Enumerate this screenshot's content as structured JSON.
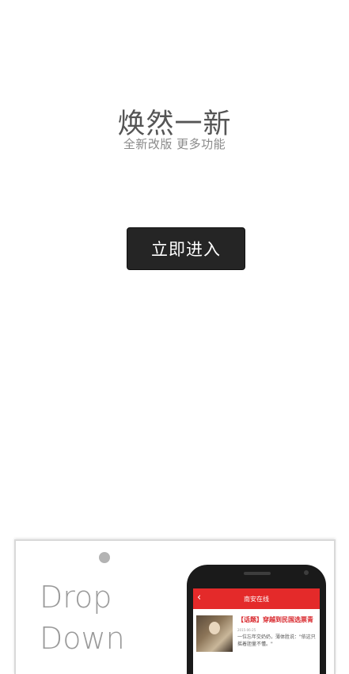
{
  "splash": {
    "headline": "焕然一新",
    "subhead": "全新改版  更多功能",
    "enter_button": "立即进入"
  },
  "promo": {
    "line1": "Drop",
    "line2": "Down",
    "phone": {
      "app_title": "南安在线",
      "news_title": "【话题】穿越到民国选票青",
      "news_date": "2015-06-25",
      "news_snippet": "一位忘年交奶奶，薄体胜说：\"依这只摇着胆量不懂。\""
    }
  }
}
